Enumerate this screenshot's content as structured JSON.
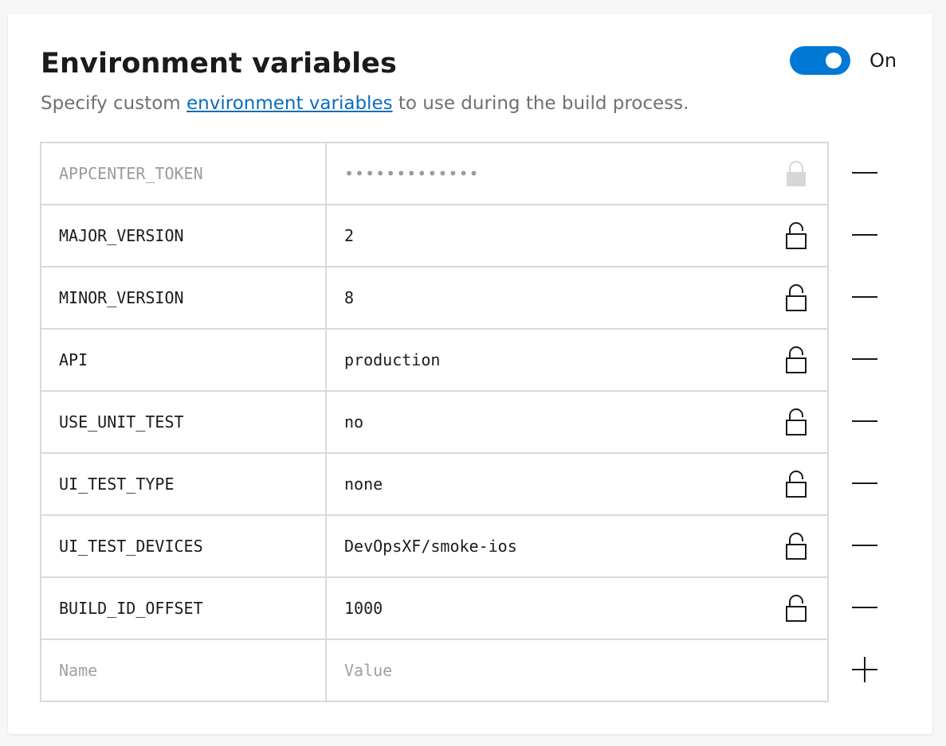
{
  "header": {
    "title": "Environment variables",
    "subtitle_before": "Specify custom ",
    "subtitle_link": "environment variables",
    "subtitle_after": " to use during the build process.",
    "toggle_state": "On",
    "toggle_on": true
  },
  "variables": [
    {
      "name": "APPCENTER_TOKEN",
      "value": "•••••••••••••",
      "secret": true
    },
    {
      "name": "MAJOR_VERSION",
      "value": "2",
      "secret": false
    },
    {
      "name": "MINOR_VERSION",
      "value": "8",
      "secret": false
    },
    {
      "name": "API",
      "value": "production",
      "secret": false
    },
    {
      "name": "USE_UNIT_TEST",
      "value": "no",
      "secret": false
    },
    {
      "name": "UI_TEST_TYPE",
      "value": "none",
      "secret": false
    },
    {
      "name": "UI_TEST_DEVICES",
      "value": "DevOpsXF/smoke-ios",
      "secret": false
    },
    {
      "name": "BUILD_ID_OFFSET",
      "value": "1000",
      "secret": false
    }
  ],
  "new_row": {
    "name_placeholder": "Name",
    "value_placeholder": "Value"
  },
  "icons": {
    "lock": "unlocked-padlock-icon",
    "locked": "locked-padlock-icon",
    "remove": "minus-icon",
    "add": "plus-icon"
  },
  "colors": {
    "accent": "#0078d4",
    "link": "#0b6cbd",
    "border": "#d9d9d9",
    "muted_text": "#9b9b9b"
  }
}
